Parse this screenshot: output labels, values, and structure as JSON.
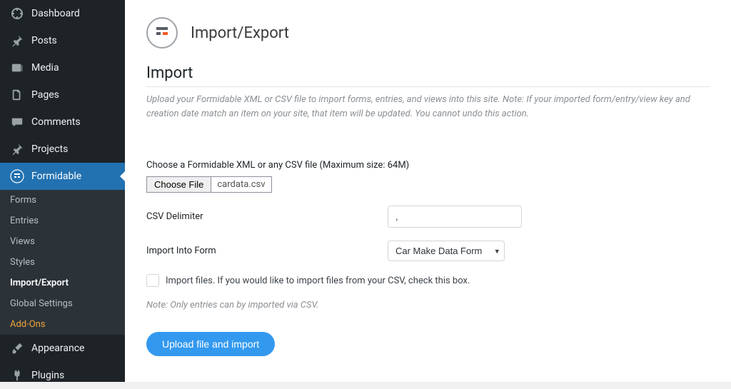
{
  "sidebar": {
    "items": [
      {
        "label": "Dashboard"
      },
      {
        "label": "Posts"
      },
      {
        "label": "Media"
      },
      {
        "label": "Pages"
      },
      {
        "label": "Comments"
      },
      {
        "label": "Projects"
      },
      {
        "label": "Formidable"
      },
      {
        "label": "Appearance"
      },
      {
        "label": "Plugins"
      }
    ],
    "submenu": [
      {
        "label": "Forms"
      },
      {
        "label": "Entries"
      },
      {
        "label": "Views"
      },
      {
        "label": "Styles"
      },
      {
        "label": "Import/Export"
      },
      {
        "label": "Global Settings"
      },
      {
        "label": "Add-Ons"
      }
    ]
  },
  "header": {
    "title": "Import/Export"
  },
  "import_section": {
    "heading": "Import",
    "description": "Upload your Formidable XML or CSV file to import forms, entries, and views into this site. Note: If your imported form/entry/view key and creation date match an item on your site, that item will be updated. You cannot undo this action.",
    "choose_file_label": "Choose a Formidable XML or any CSV file (Maximum size: 64M)",
    "choose_file_button": "Choose File",
    "chosen_file_name": "cardata.csv",
    "csv_delimiter_label": "CSV Delimiter",
    "csv_delimiter_value": ",",
    "import_into_label": "Import Into Form",
    "import_into_value": "Car Make Data Form",
    "import_files_checkbox_label": "Import files. If you would like to import files from your CSV, check this box.",
    "csv_note": "Note: Only entries can by imported via CSV.",
    "submit_button": "Upload file and import"
  }
}
